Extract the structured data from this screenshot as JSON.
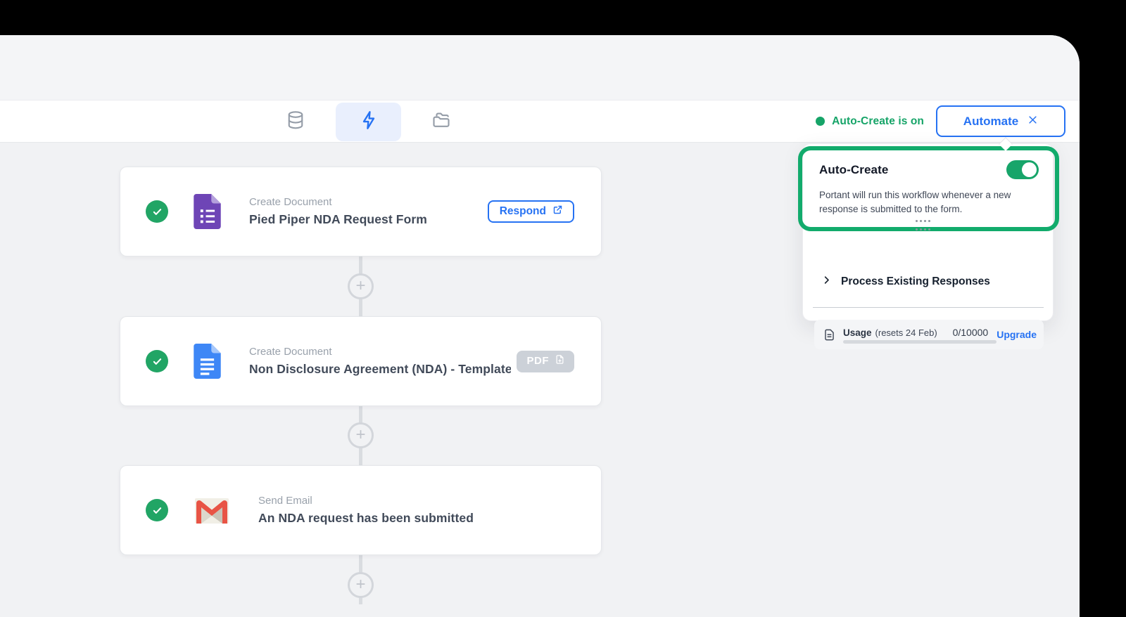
{
  "toolbar": {
    "tabs": [
      {
        "id": "source",
        "icon": "database-icon",
        "active": false
      },
      {
        "id": "automation",
        "icon": "lightning-icon",
        "active": true
      },
      {
        "id": "output",
        "icon": "folder-icon",
        "active": false
      }
    ],
    "status_label": "Auto-Create is on",
    "automate_label": "Automate"
  },
  "workflow": {
    "steps": [
      {
        "app": "google-forms",
        "type_label": "Create Document",
        "title": "Pied Piper NDA Request Form",
        "action_label": "Respond"
      },
      {
        "app": "google-docs",
        "type_label": "Create Document",
        "title": "Non Disclosure Agreement (NDA) - Template",
        "badge_label": "PDF"
      },
      {
        "app": "gmail",
        "type_label": "Send Email",
        "title": "An NDA request has been submitted"
      }
    ]
  },
  "popover": {
    "title": "Auto-Create",
    "toggle_state": "on",
    "description": "Portant will run this workflow whenever a new response is submitted to the form.",
    "process_label": "Process Existing Responses",
    "usage": {
      "label": "Usage",
      "resets": "(resets 24 Feb)",
      "count": "0/10000",
      "upgrade_label": "Upgrade",
      "progress_percent": 0
    }
  },
  "colors": {
    "accent_green": "#16a468",
    "accent_blue": "#2672f3",
    "highlight_frame": "#12ab6c",
    "canvas_gray": "#f1f2f4",
    "badge_gray": "#ccd1d8",
    "forms_purple": "#6e45b6",
    "docs_blue": "#3e87f6",
    "gmail_red": "#e85445"
  }
}
